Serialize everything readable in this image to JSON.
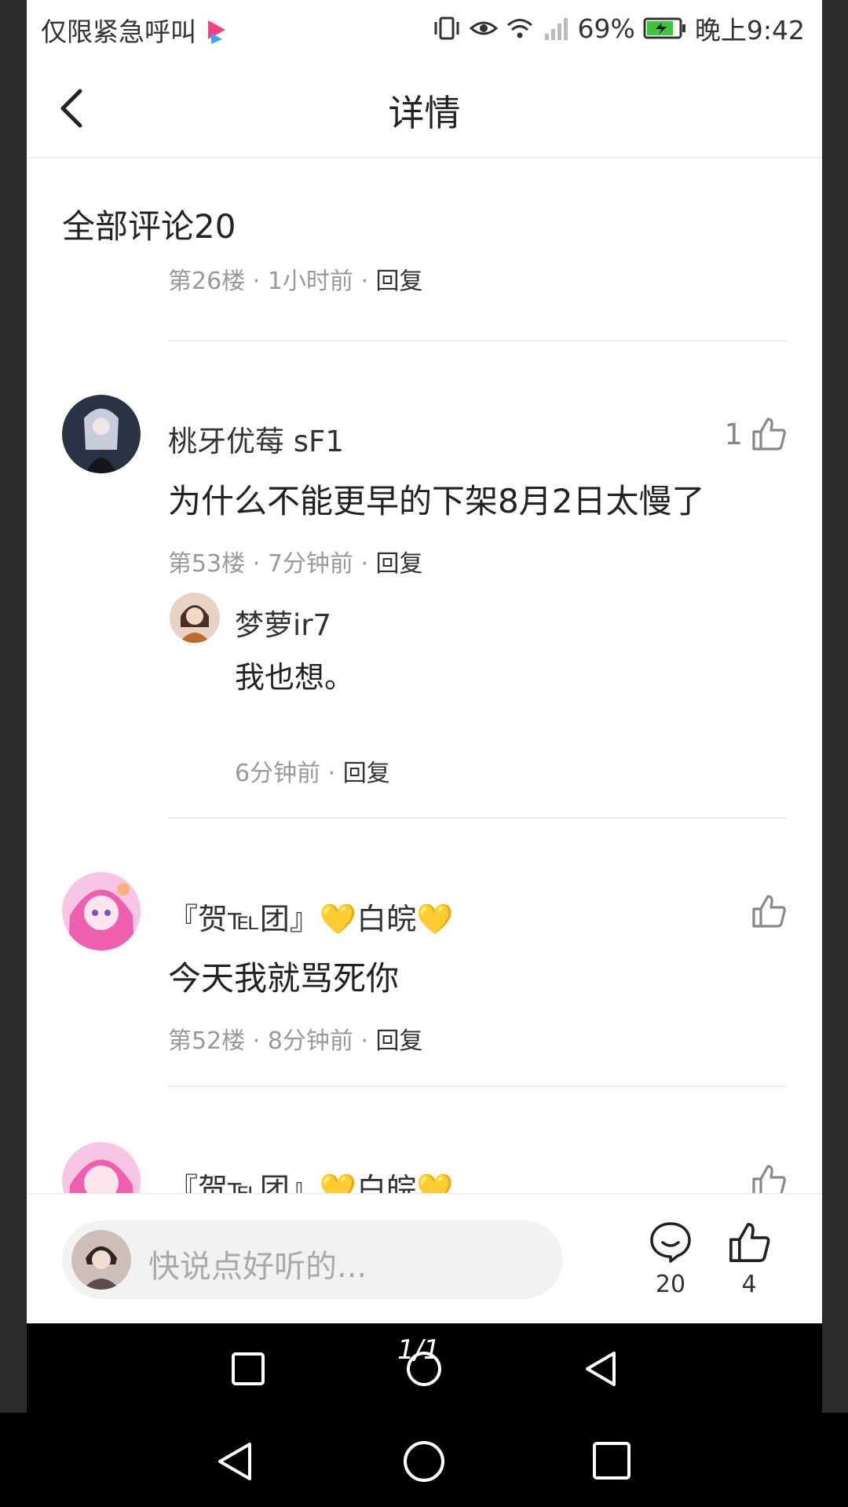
{
  "status_bar": {
    "left_text": "仅限紧急呼叫",
    "battery": "69%",
    "time": "晚上9:42"
  },
  "header": {
    "title": "详情"
  },
  "comments_header": "全部评论20",
  "partial_top_meta": {
    "floor": "第26楼",
    "time": "1小时前",
    "reply": "回复"
  },
  "comments": [
    {
      "user": "桃牙优莓 sF1",
      "likes": "1",
      "text": "为什么不能更早的下架8月2日太慢了",
      "floor": "第53楼",
      "time": "7分钟前",
      "reply": "回复",
      "sub_reply": {
        "user": "梦萝ir7",
        "text": "我也想。",
        "time": "6分钟前",
        "reply": "回复"
      }
    },
    {
      "user": "『贺℡团』💛白皖💛",
      "likes": "",
      "text": "今天我就骂死你",
      "floor": "第52楼",
      "time": "8分钟前",
      "reply": "回复"
    },
    {
      "user": "『贺℡团』💛白皖💛",
      "likes": ""
    }
  ],
  "bottom_bar": {
    "input_placeholder": "快说点好听的...",
    "comment_count": "20",
    "like_count": "4"
  },
  "page_indicator": "1/1",
  "colors": {
    "accent": "#ffb400",
    "meta": "#999999",
    "nav_bg": "#000000"
  }
}
